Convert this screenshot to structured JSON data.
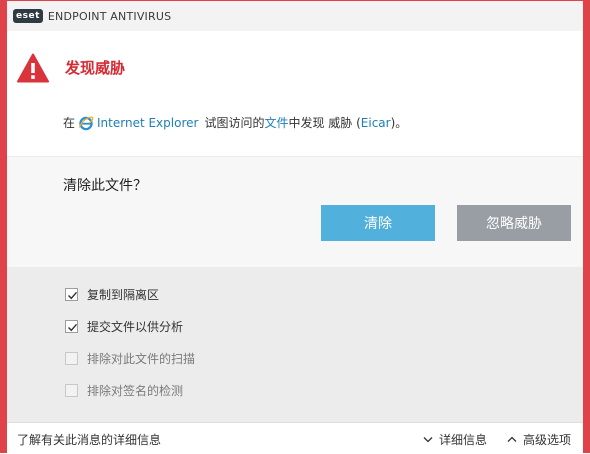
{
  "titlebar": {
    "logo": "eset",
    "title": "ENDPOINT ANTIVIRUS"
  },
  "alert": {
    "icon": "warning-triangle-icon",
    "title": "发现威胁",
    "message_prefix": "在",
    "browser_icon": "internet-explorer-icon",
    "browser_link": "Internet Explorer",
    "message_mid": "试图访问的",
    "file_link": "文件",
    "message_mid2": "中发现 威胁 (",
    "threat_link": "Eicar",
    "message_suffix": ")。"
  },
  "question": {
    "text": "清除此文件？",
    "clean_button": "清除",
    "ignore_button": "忽略威胁"
  },
  "options": [
    {
      "label": "复制到隔离区",
      "checked": true
    },
    {
      "label": "提交文件以供分析",
      "checked": true
    },
    {
      "label": "排除对此文件的扫描",
      "checked": false
    },
    {
      "label": "排除对签名的检测",
      "checked": false
    }
  ],
  "footer": {
    "learn_more": "了解有关此消息的详细信息",
    "details": "详细信息",
    "advanced": "高级选项"
  },
  "colors": {
    "accent_red": "#e0424a",
    "title_red": "#d52b34",
    "link_blue": "#1e7fb7",
    "clean_button": "#52b0dc",
    "ignore_button": "#989ea3"
  }
}
